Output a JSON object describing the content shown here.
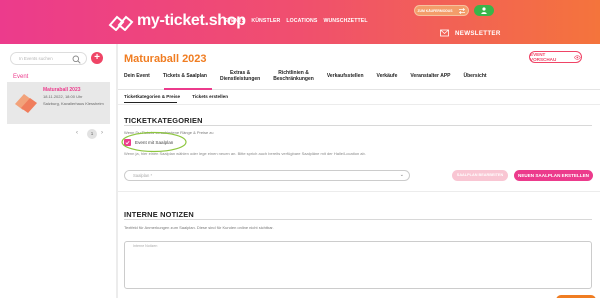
{
  "header": {
    "logo_text": "my-ticket.shop",
    "nav": [
      "EVENTS",
      "KÜNSTLER",
      "LOCATIONS",
      "WUNSCHZETTEL"
    ],
    "switch_label": "ZUM KÄUFERMODUS",
    "newsletter_label": "NEWSLETTER"
  },
  "sidebar": {
    "search_placeholder": "In Events suchen",
    "add_label": "+",
    "section_label": "Event",
    "event": {
      "name": "Maturaball 2023",
      "date": "18.11.2022, 18:00 Uhr",
      "venue": "Salzburg, Kavalierhaus Klessheim"
    },
    "pager": {
      "prev": "‹",
      "current": "1",
      "next": "›"
    }
  },
  "main": {
    "title": "Maturaball 2023",
    "preview_label": "EVENT VORSCHAU",
    "tabs": [
      {
        "line1": "Dein Event",
        "line2": ""
      },
      {
        "line1": "Tickets & Saalplan",
        "line2": ""
      },
      {
        "line1": "Extras &",
        "line2": "Dienstleistungen"
      },
      {
        "line1": "Richtlinien &",
        "line2": "Beschränkungen"
      },
      {
        "line1": "Verkaufsstellen",
        "line2": ""
      },
      {
        "line1": "Verkäufe",
        "line2": ""
      },
      {
        "line1": "Veranstalter APP",
        "line2": ""
      },
      {
        "line1": "Übersicht",
        "line2": ""
      }
    ],
    "subtabs": [
      "Ticketkategorien & Preise",
      "Tickets erstellen"
    ],
    "section1": {
      "title": "TICKETKATEGORIEN",
      "intro": "Wenn Du Tickets verschiedene Ränge & Preise zu",
      "checkbox_label": "Event mit Saalplan",
      "checkbox_checked": true,
      "hint": "Wenn ja, hier einen Saalplan wählen oder lege einen neuen an. Bitte sprich auch bereits verfügbare Saalpläne mit der Halle/Location ab.",
      "select_placeholder": "Saalplan *",
      "disabled_button": "SAALPLAN BEARBEITEN",
      "new_button": "NEUEN SAALPLAN ERSTELLEN"
    },
    "section2": {
      "title": "INTERNE NOTIZEN",
      "hint": "Textfeld für Anmerkungen zum Saalplan. Diese sind für Kunden online nicht sichtbar.",
      "textarea_label": "Interne Notizen"
    }
  },
  "colors": {
    "brand_pink": "#ec3b8c",
    "brand_orange": "#f07d22",
    "highlight_green": "#8dc63f"
  }
}
